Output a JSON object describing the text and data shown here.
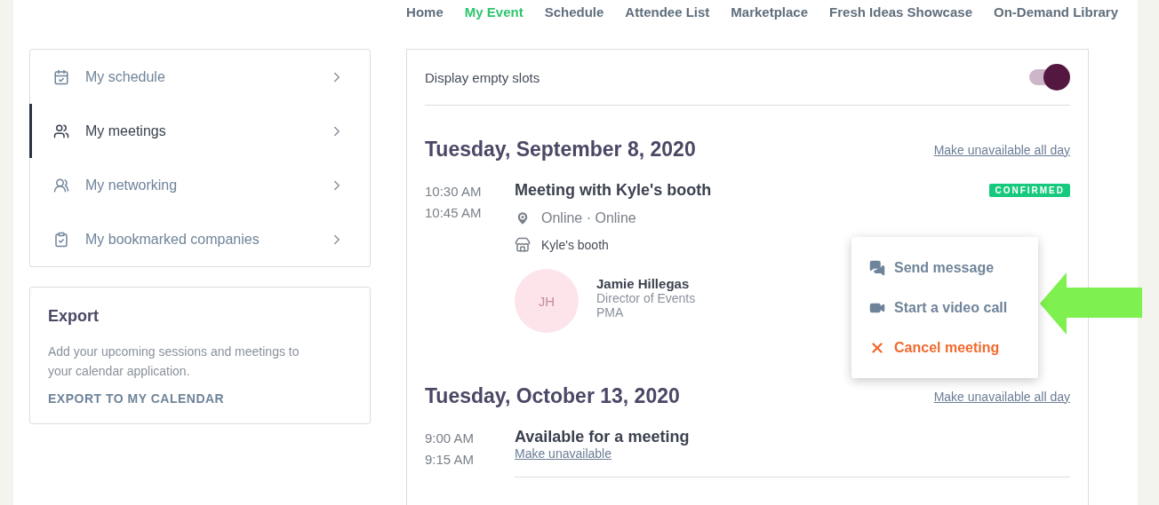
{
  "nav": [
    {
      "label": "Home",
      "selected": false
    },
    {
      "label": "My Event",
      "selected": true
    },
    {
      "label": "Schedule",
      "selected": false
    },
    {
      "label": "Attendee List",
      "selected": false
    },
    {
      "label": "Marketplace",
      "selected": false
    },
    {
      "label": "Fresh Ideas Showcase",
      "selected": false
    },
    {
      "label": "On-Demand Library",
      "selected": false
    }
  ],
  "sidebar": {
    "items": [
      {
        "label": "My schedule",
        "selected": false
      },
      {
        "label": "My meetings",
        "selected": true
      },
      {
        "label": "My networking",
        "selected": false
      },
      {
        "label": "My bookmarked companies",
        "selected": false
      }
    ]
  },
  "export": {
    "title": "Export",
    "text": "Add your upcoming sessions and meetings to your calendar application.",
    "link": "EXPORT TO MY CALENDAR"
  },
  "panel": {
    "toggle": {
      "label": "Display empty slots",
      "on": true
    },
    "days": [
      {
        "date": "Tuesday, September 8, 2020",
        "action": "Make unavailable all day",
        "slots": [
          {
            "kind": "meeting",
            "start": "10:30 AM",
            "end": "10:45 AM",
            "title": "Meeting with Kyle's booth",
            "status": "CONFIRMED",
            "location": "Online · Online",
            "booth": "Kyle's booth",
            "person": {
              "initials": "JH",
              "name": "Jamie Hillegas",
              "role": "Director of Events",
              "company": "PMA"
            }
          }
        ]
      },
      {
        "date": "Tuesday, October 13, 2020",
        "action": "Make unavailable all day",
        "slots": [
          {
            "kind": "available",
            "start": "9:00 AM",
            "end": "9:15 AM",
            "title": "Available for a meeting",
            "link": "Make unavailable"
          }
        ]
      }
    ]
  },
  "menu": {
    "items": [
      {
        "label": "Send message",
        "kind": "message"
      },
      {
        "label": "Start a video call",
        "kind": "video"
      },
      {
        "label": "Cancel meeting",
        "kind": "cancel"
      }
    ]
  }
}
